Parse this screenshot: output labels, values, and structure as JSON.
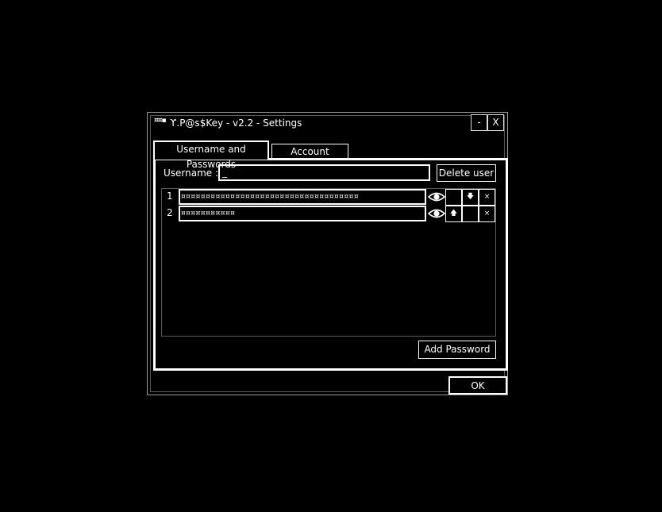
{
  "window": {
    "logo": "¤¤▪",
    "title": "ϒ.P@s$Key - v2.2 - Settings",
    "minimize_label": "-",
    "close_label": "X"
  },
  "tabs": [
    {
      "label": "Username and Passwords",
      "active": true
    },
    {
      "label": "Account settings",
      "active": false
    }
  ],
  "user": {
    "label": "Username :",
    "value": "_",
    "delete_label": "Delete user"
  },
  "passwords": [
    {
      "index": "1",
      "masked": "¤¤¤¤¤¤¤¤¤¤¤¤¤¤¤¤¤¤¤¤¤¤¤¤¤¤¤¤¤¤¤¤¤¤¤¤",
      "up_label": "",
      "down_label": "🡇",
      "delete_label": "×"
    },
    {
      "index": "2",
      "masked": "¤¤¤¤¤¤¤¤¤¤¤",
      "up_label": "🡅",
      "down_label": "",
      "delete_label": "×"
    }
  ],
  "actions": {
    "add_password_label": "Add Password",
    "ok_label": "OK"
  }
}
